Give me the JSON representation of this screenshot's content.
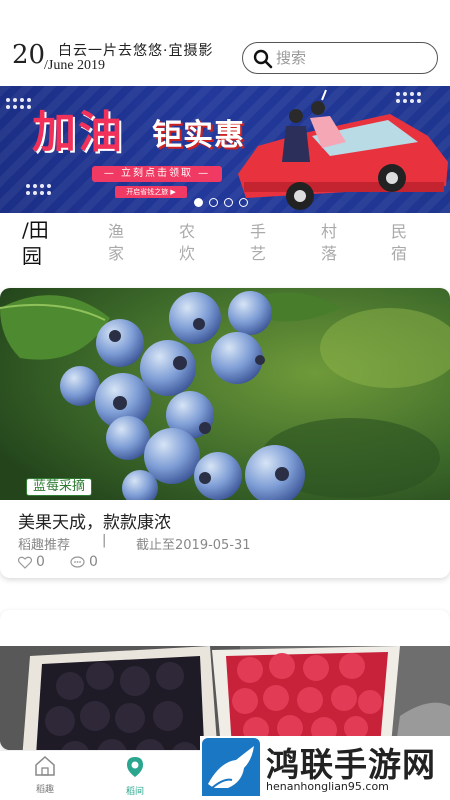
{
  "header": {
    "day": "20",
    "month_year": "/June 2019",
    "motto": "白云一片去悠悠·宜摄影",
    "search_placeholder": "搜索"
  },
  "banner": {
    "title_a": "加油",
    "title_b": "钜实惠",
    "subtitle": "— 立刻点击领取 —",
    "tag": "开启省钱之旅 ▶",
    "slide_count": 4,
    "active_slide": 1
  },
  "category_tabs": [
    {
      "label": "/田园",
      "active": true
    },
    {
      "label": "渔家",
      "active": false
    },
    {
      "label": "农炊",
      "active": false
    },
    {
      "label": "手艺",
      "active": false
    },
    {
      "label": "村落",
      "active": false
    },
    {
      "label": "民宿",
      "active": false
    }
  ],
  "cards": [
    {
      "tag": "蓝莓采摘",
      "title": "美果天成，款款康浓",
      "source": "稻趣推荐",
      "separator": "|",
      "deadline": "截止至2019-05-31",
      "likes": "0",
      "comments": "0"
    }
  ],
  "bottom_nav": [
    {
      "label": "稻趣",
      "icon": "home-icon",
      "active": false
    },
    {
      "label": "稻间",
      "icon": "location-pin-icon",
      "active": true
    }
  ],
  "watermark": {
    "title": "鸿联手游网",
    "url": "henanhonglian95.com"
  },
  "colors": {
    "accent": "#2aa58e",
    "tag_green": "#2e7d32",
    "banner_bg": "#1f3690",
    "banner_pink": "#f03a63"
  }
}
